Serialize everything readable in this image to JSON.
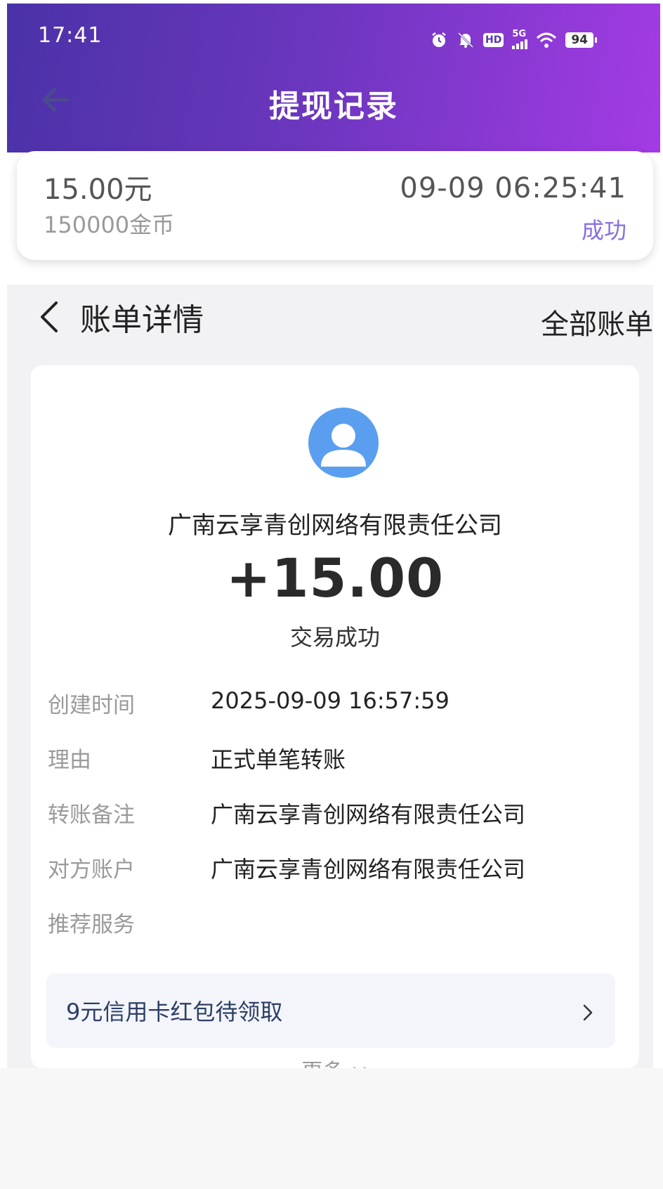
{
  "status_bar": {
    "time": "17:41",
    "icons": [
      "alarm-icon",
      "mute-icon",
      "hd-icon",
      "5g-signal-icon",
      "wifi-icon",
      "battery-icon"
    ],
    "hd_label": "HD",
    "network_label": "5G",
    "battery_level": "94"
  },
  "nav": {
    "back_icon": "arrow-left-icon",
    "title": "提现记录"
  },
  "record": {
    "amount": "15.00元",
    "coins": "150000金币",
    "time": "09-09 06:25:41",
    "status": "成功",
    "status_color": "#8a6fe0"
  },
  "bill_detail": {
    "back_icon": "chevron-left-icon",
    "title": "账单详情",
    "all_bills": "全部账单",
    "avatar_icon": "user-avatar-icon",
    "avatar_color": "#5a9ef0",
    "payee": "广南云享青创网络有限责任公司",
    "amount": "+15.00",
    "status": "交易成功",
    "fields": [
      {
        "label": "创建时间",
        "value": "2025-09-09 16:57:59"
      },
      {
        "label": "理由",
        "value": "正式单笔转账"
      },
      {
        "label": "转账备注",
        "value": "广南云享青创网络有限责任公司"
      },
      {
        "label": "对方账户",
        "value": "广南云享青创网络有限责任公司"
      },
      {
        "label": "推荐服务",
        "value": ""
      }
    ],
    "promo": {
      "text": "9元信用卡红包待领取",
      "icon": "chevron-right-icon"
    },
    "more": "更多",
    "more_icon": "chevron-down-icon"
  },
  "colors": {
    "header_gradient_start": "#4a32a8",
    "header_gradient_end": "#a33be4"
  }
}
